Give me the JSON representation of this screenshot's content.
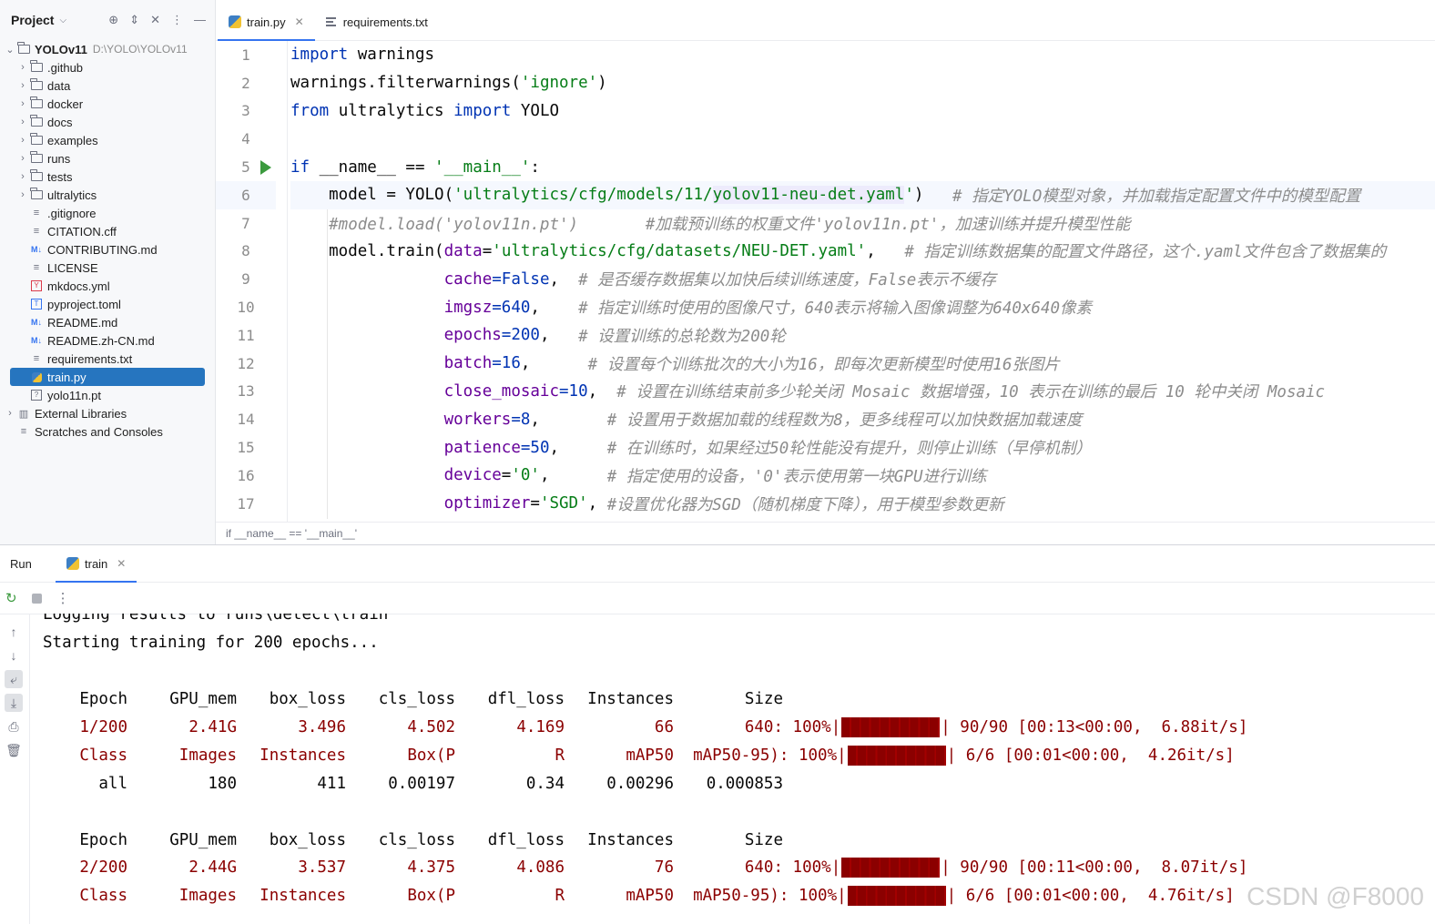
{
  "project": {
    "title": "Project",
    "root": {
      "name": "YOLOv11",
      "path": "D:\\YOLO\\YOLOv11"
    },
    "items": [
      {
        "label": ".github",
        "type": "folder"
      },
      {
        "label": "data",
        "type": "folder"
      },
      {
        "label": "docker",
        "type": "folder"
      },
      {
        "label": "docs",
        "type": "folder"
      },
      {
        "label": "examples",
        "type": "folder"
      },
      {
        "label": "runs",
        "type": "folder"
      },
      {
        "label": "tests",
        "type": "folder"
      },
      {
        "label": "ultralytics",
        "type": "folder"
      },
      {
        "label": ".gitignore",
        "type": "file"
      },
      {
        "label": "CITATION.cff",
        "type": "file"
      },
      {
        "label": "CONTRIBUTING.md",
        "type": "md"
      },
      {
        "label": "LICENSE",
        "type": "file"
      },
      {
        "label": "mkdocs.yml",
        "type": "yml"
      },
      {
        "label": "pyproject.toml",
        "type": "toml"
      },
      {
        "label": "README.md",
        "type": "md"
      },
      {
        "label": "README.zh-CN.md",
        "type": "md"
      },
      {
        "label": "requirements.txt",
        "type": "file"
      },
      {
        "label": "train.py",
        "type": "py"
      },
      {
        "label": "yolo11n.pt",
        "type": "pt"
      }
    ],
    "external_libraries": "External Libraries",
    "scratches": "Scratches and Consoles"
  },
  "editor": {
    "tabs": [
      {
        "label": "train.py",
        "active": true
      },
      {
        "label": "requirements.txt",
        "active": false
      }
    ],
    "line_numbers": [
      "1",
      "2",
      "3",
      "4",
      "5",
      "6",
      "7",
      "8",
      "9",
      "10",
      "11",
      "12",
      "13",
      "14",
      "15",
      "16",
      "17"
    ],
    "breadcrumb": "if __name__ == '__main__'",
    "code": {
      "l1_kw": "import",
      "l1_rest": " warnings",
      "l2_a": "warnings.filterwarnings(",
      "l2_str": "'ignore'",
      "l2_b": ")",
      "l3_kw1": "from",
      "l3_mid": " ultralytics ",
      "l3_kw2": "import",
      "l3_rest": " YOLO",
      "l5_kw": "if",
      "l5_mid": " __name__ == ",
      "l5_str": "'__main__'",
      "l5_end": ":",
      "l6_a": "    model = YOLO(",
      "l6_str1": "'ultralytics/cfg/models/11/",
      "l6_str2": "yolov11-neu-det.yaml",
      "l6_str3": "'",
      "l6_b": ")   ",
      "l6_cm": "# 指定YOLO模型对象，并加载指定配置文件中的模型配置",
      "l7_cm": "    #model.load('yolov11n.pt')       #加载预训练的权重文件'yolov11n.pt'，加速训练并提升模型性能",
      "l8_a": "    model.train(",
      "l8_p": "data",
      "l8_eq": "=",
      "l8_str": "'ultralytics/cfg/datasets/NEU-DET.yaml'",
      "l8_b": ",   ",
      "l8_cm": "# 指定训练数据集的配置文件路径，这个.yaml文件包含了数据集的",
      "l9_p": "cache",
      "l9_v": "=False",
      "l9_b": ",  ",
      "l9_cm": "# 是否缓存数据集以加快后续训练速度，False表示不缓存",
      "l10_p": "imgsz",
      "l10_v": "=640",
      "l10_b": ",    ",
      "l10_cm": "# 指定训练时使用的图像尺寸，640表示将输入图像调整为640x640像素",
      "l11_p": "epochs",
      "l11_v": "=200",
      "l11_b": ",   ",
      "l11_cm": "# 设置训练的总轮数为200轮",
      "l12_p": "batch",
      "l12_v": "=16",
      "l12_b": ",      ",
      "l12_cm": "# 设置每个训练批次的大小为16，即每次更新模型时使用16张图片",
      "l13_p": "close_mosaic",
      "l13_v": "=10",
      "l13_b": ",  ",
      "l13_cm": "# 设置在训练结束前多少轮关闭 Mosaic 数据增强，10 表示在训练的最后 10 轮中关闭 Mosaic",
      "l14_p": "workers",
      "l14_v": "=8",
      "l14_b": ",       ",
      "l14_cm": "# 设置用于数据加载的线程数为8，更多线程可以加快数据加载速度",
      "l15_p": "patience",
      "l15_v": "=50",
      "l15_b": ",     ",
      "l15_cm": "# 在训练时，如果经过50轮性能没有提升，则停止训练（早停机制）",
      "l16_p": "device",
      "l16_v": "=",
      "l16_str": "'0'",
      "l16_b": ",      ",
      "l16_cm": "# 指定使用的设备，'0'表示使用第一块GPU进行训练",
      "l17_p": "optimizer",
      "l17_v": "=",
      "l17_str": "'SGD'",
      "l17_b": ", ",
      "l17_cm": "#设置优化器为SGD（随机梯度下降），用于模型参数更新"
    }
  },
  "run": {
    "title": "Run",
    "tab_label": "train",
    "console": {
      "line_partial": "Logging results to runs\\detect\\train",
      "line_start": "Starting training for 200 epochs...",
      "header": [
        "Epoch",
        "GPU_mem",
        "box_loss",
        "cls_loss",
        "dfl_loss",
        "Instances",
        "Size"
      ],
      "epochs": [
        {
          "train": [
            "1/200",
            "2.41G",
            "3.496",
            "4.502",
            "4.169",
            "66",
            "640:"
          ],
          "train_pct": "100%|",
          "train_tail": "| 90/90 [00:13<00:00,  6.88it/s]",
          "val_header": [
            "Class",
            "Images",
            "Instances",
            "Box(P",
            "R",
            "mAP50"
          ],
          "val_pct": "mAP50-95): 100%|",
          "val_tail": "| 6/6 [00:01<00:00,  4.26it/s]",
          "val": [
            "all",
            "180",
            "411",
            "0.00197",
            "0.34",
            "0.00296",
            "0.000853"
          ]
        },
        {
          "train": [
            "2/200",
            "2.44G",
            "3.537",
            "4.375",
            "4.086",
            "76",
            "640:"
          ],
          "train_pct": "100%|",
          "train_tail": "| 90/90 [00:11<00:00,  8.07it/s]",
          "val_header": [
            "Class",
            "Images",
            "Instances",
            "Box(P",
            "R",
            "mAP50"
          ],
          "val_pct": "mAP50-95): 100%|",
          "val_tail": "| 6/6 [00:01<00:00,  4.76it/s]"
        }
      ],
      "progress": 1.0
    },
    "watermark": "CSDN @F8000"
  }
}
